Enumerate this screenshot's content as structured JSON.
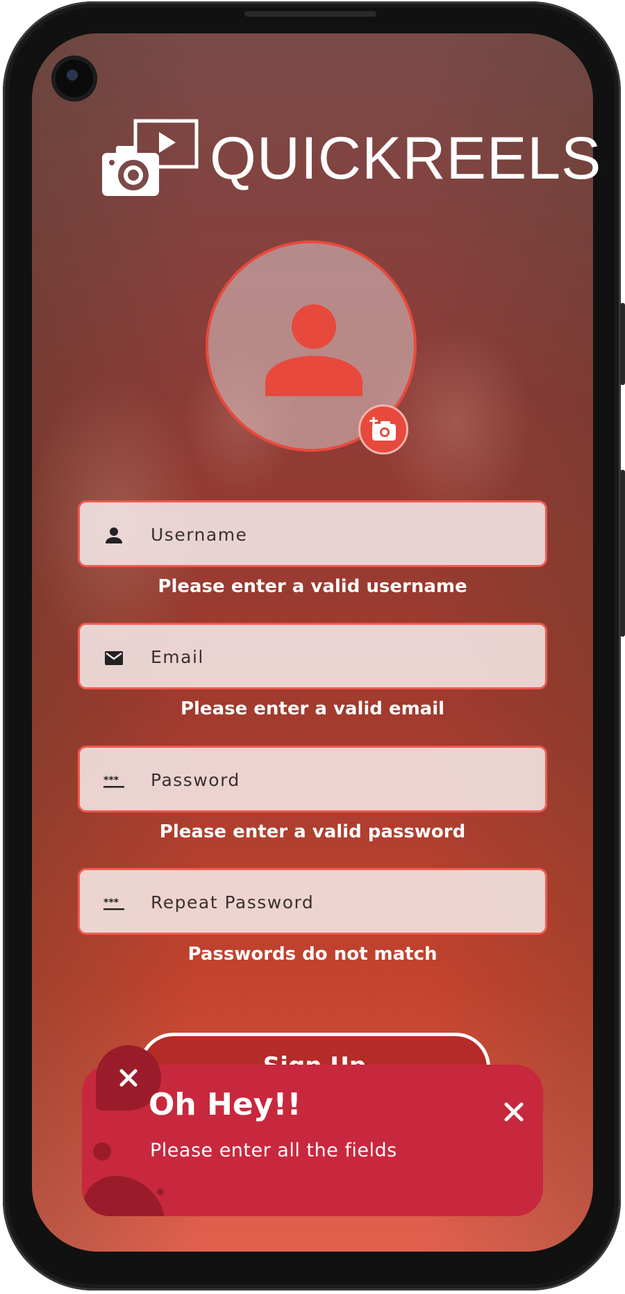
{
  "app": {
    "brand": "QUICKREELS"
  },
  "form": {
    "username": {
      "placeholder": "Username",
      "error": "Please enter a valid username"
    },
    "email": {
      "placeholder": "Email",
      "error": "Please enter a valid email"
    },
    "password": {
      "placeholder": "Password",
      "error": "Please enter a valid password"
    },
    "repeat_password": {
      "placeholder": "Repeat Password",
      "error": "Passwords do not match"
    },
    "submit_label": "Sign Up"
  },
  "toast": {
    "title": "Oh Hey!!",
    "message": "Please enter all the fields"
  },
  "colors": {
    "accent": "#e8493d",
    "toast_bg": "#c8283d",
    "toast_dark": "#9a1c2b"
  },
  "icons": {
    "logo": "camera-video-logo-icon",
    "avatar": "person-icon",
    "add_photo": "add-photo-camera-icon",
    "username": "person-icon",
    "email": "mail-icon",
    "password": "password-dots-icon",
    "close": "close-icon"
  }
}
